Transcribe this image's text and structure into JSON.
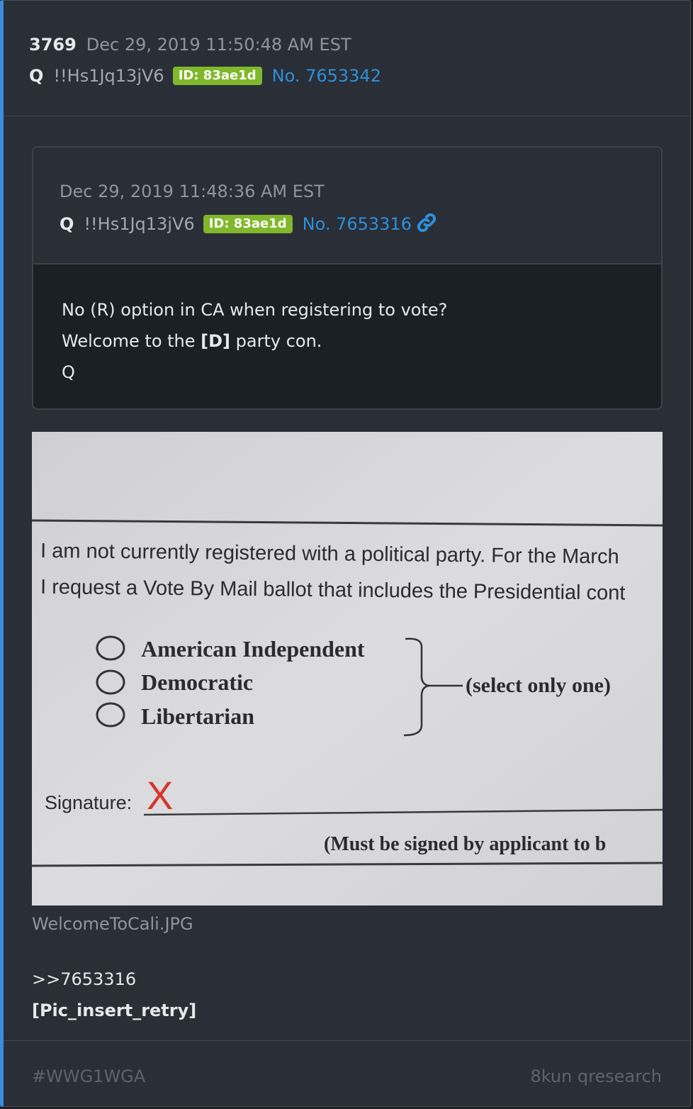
{
  "post": {
    "number": "3769",
    "date": "Dec 29, 2019 11:50:48 AM EST",
    "name": "Q",
    "tripcode": "!!Hs1Jq13jV6",
    "id_badge": "ID: 83ae1d",
    "post_no": "No. 7653342"
  },
  "quoted_post": {
    "date": "Dec 29, 2019 11:48:36 AM EST",
    "name": "Q",
    "tripcode": "!!Hs1Jq13jV6",
    "id_badge": "ID: 83ae1d",
    "post_no": "No. 7653316",
    "link_icon": "link-icon",
    "line1": "No (R) option in CA when registering to vote?",
    "line2_before": "Welcome to the ",
    "line2_bold": "[D]",
    "line2_after": " party con.",
    "line3": "Q"
  },
  "image": {
    "text_line1": "I am not currently registered with a political party. For the March",
    "text_line2": "I request a Vote By Mail ballot that includes the Presidential cont",
    "options": [
      "American Independent",
      "Democratic",
      "Libertarian"
    ],
    "bracket_note": "(select only one)",
    "signature_label": "Signature:",
    "signature_mark": "X",
    "footnote": "(Must be signed by applicant to b"
  },
  "filename": "WelcomeToCali.JPG",
  "reply_ref": ">>7653316",
  "pic_insert": "[Pic_insert_retry]",
  "footer": {
    "hashtag": "#WWG1WGA",
    "source": "8kun qresearch"
  },
  "colors": {
    "background": "#292e37",
    "accent_border": "#3b8ddb",
    "id_badge": "#7fb82a",
    "post_link": "#2f8fd8",
    "signature_mark": "#d8352f"
  }
}
